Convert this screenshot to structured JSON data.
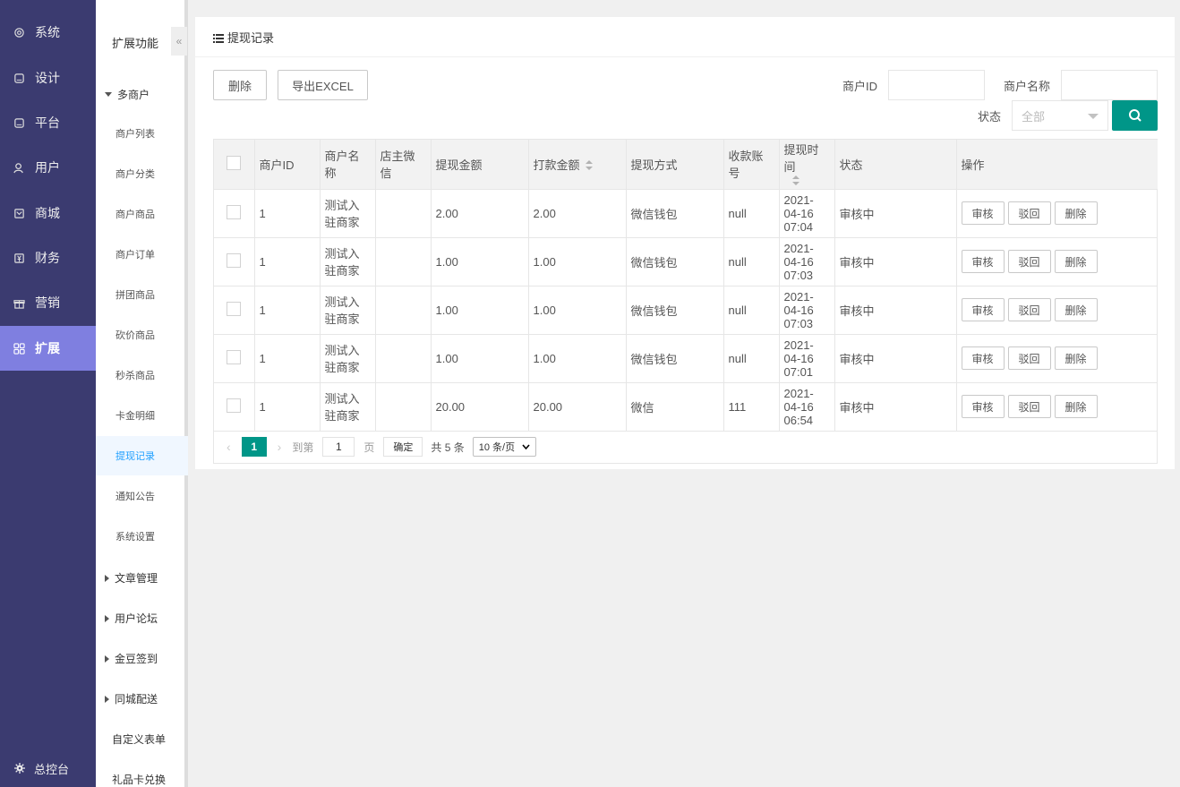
{
  "nav": {
    "items": [
      {
        "label": "系统",
        "icon": "gear-icon"
      },
      {
        "label": "设计",
        "icon": "design-icon"
      },
      {
        "label": "平台",
        "icon": "platform-icon"
      },
      {
        "label": "用户",
        "icon": "user-icon"
      },
      {
        "label": "商城",
        "icon": "mall-icon"
      },
      {
        "label": "财务",
        "icon": "finance-icon"
      },
      {
        "label": "营销",
        "icon": "gift-icon"
      },
      {
        "label": "扩展",
        "icon": "grid-icon"
      }
    ],
    "active_index": 7,
    "bottom_label": "总控台"
  },
  "subnav": {
    "title": "扩展功能",
    "group_open": "多商户",
    "items": [
      "商户列表",
      "商户分类",
      "商户商品",
      "商户订单",
      "拼团商品",
      "砍价商品",
      "秒杀商品",
      "卡金明细",
      "提现记录",
      "通知公告",
      "系统设置"
    ],
    "active_item": "提现记录",
    "groups_closed": [
      "文章管理",
      "用户论坛",
      "金豆签到",
      "同城配送"
    ],
    "plain_items": [
      "自定义表单",
      "礼品卡兑换"
    ]
  },
  "panel": {
    "title": "提现记录"
  },
  "toolbar": {
    "delete_label": "删除",
    "export_label": "导出EXCEL"
  },
  "filters": {
    "merchant_id_label": "商户ID",
    "merchant_id_value": "",
    "merchant_name_label": "商户名称",
    "merchant_name_value": "",
    "status_label": "状态",
    "status_value": "全部"
  },
  "table": {
    "headers": [
      "商户ID",
      "商户名称",
      "店主微信",
      "提现金额",
      "打款金额",
      "提现方式",
      "收款账号",
      "提现时间",
      "状态",
      "操作"
    ],
    "rows": [
      {
        "merchant_id": "1",
        "merchant_name": "测试入驻商家",
        "wechat": "",
        "amount": "2.00",
        "paid": "2.00",
        "method": "微信钱包",
        "account": "null",
        "time": "2021-04-16 07:04",
        "status": "审核中"
      },
      {
        "merchant_id": "1",
        "merchant_name": "测试入驻商家",
        "wechat": "",
        "amount": "1.00",
        "paid": "1.00",
        "method": "微信钱包",
        "account": "null",
        "time": "2021-04-16 07:03",
        "status": "审核中"
      },
      {
        "merchant_id": "1",
        "merchant_name": "测试入驻商家",
        "wechat": "",
        "amount": "1.00",
        "paid": "1.00",
        "method": "微信钱包",
        "account": "null",
        "time": "2021-04-16 07:03",
        "status": "审核中"
      },
      {
        "merchant_id": "1",
        "merchant_name": "测试入驻商家",
        "wechat": "",
        "amount": "1.00",
        "paid": "1.00",
        "method": "微信钱包",
        "account": "null",
        "time": "2021-04-16 07:01",
        "status": "审核中"
      },
      {
        "merchant_id": "1",
        "merchant_name": "测试入驻商家",
        "wechat": "",
        "amount": "20.00",
        "paid": "20.00",
        "method": "微信",
        "account": "111",
        "time": "2021-04-16 06:54",
        "status": "审核中"
      }
    ],
    "row_actions": [
      "审核",
      "驳回",
      "删除"
    ]
  },
  "pagination": {
    "current_page": "1",
    "goto_label": "到第",
    "goto_value": "1",
    "page_label": "页",
    "confirm_label": "确定",
    "total_label": "共 5 条",
    "page_size": "10 条/页"
  },
  "colors": {
    "nav_bg": "#3b3b70",
    "nav_active": "#7f7fe0",
    "primary": "#009688",
    "link_active": "#1e9fff"
  }
}
